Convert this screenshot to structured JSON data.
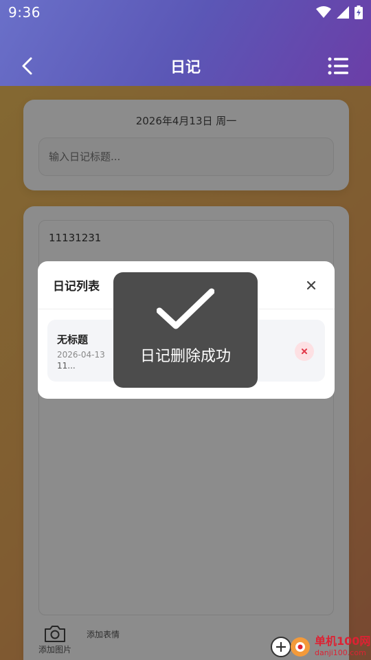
{
  "status": {
    "time": "9:36"
  },
  "header": {
    "title": "日记"
  },
  "date_card": {
    "date": "2026年4月13日 周一",
    "title_placeholder": "输入日记标题..."
  },
  "editor": {
    "content": "11131231",
    "toolbar": {
      "add_photo": "添加图片",
      "add_emoji": "添加表情"
    }
  },
  "modal": {
    "title": "日记列表",
    "items": [
      {
        "title": "无标题",
        "date": "2026-04-13",
        "preview": "11..."
      }
    ]
  },
  "toast": {
    "message": "日记删除成功"
  },
  "watermark": {
    "line1": "单机100网",
    "line2": "danji100.com"
  },
  "icons": {
    "back": "chevron-left-icon",
    "menu": "list-icon",
    "close": "close-icon",
    "delete": "delete-x-icon",
    "check": "check-icon",
    "camera": "camera-icon"
  },
  "colors": {
    "header_start": "#6a70c9",
    "header_end": "#6b3ea7",
    "background": "#f1c25b",
    "delete_accent": "#e23a4a"
  }
}
